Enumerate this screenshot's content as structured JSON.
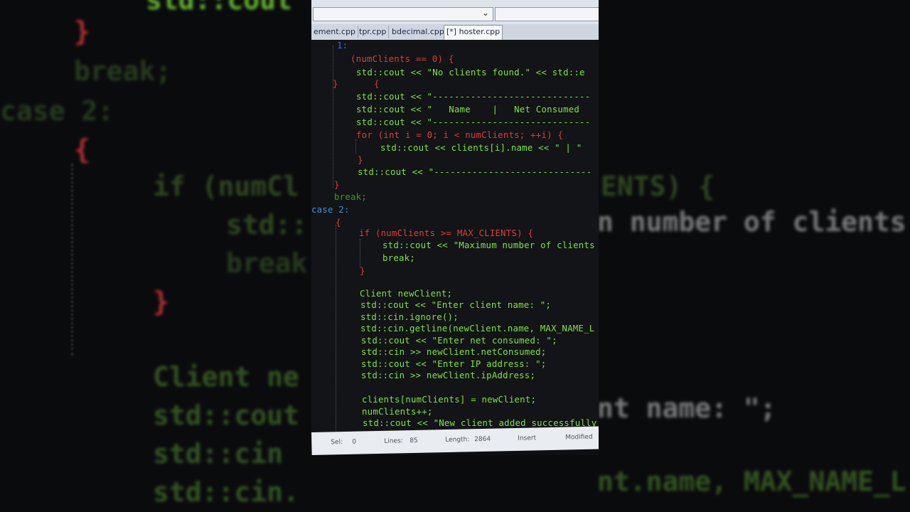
{
  "background": {
    "lines": [
      "std::cout",
      "}",
      "break;",
      "case 2:",
      "{",
      "if (numCl",
      "ENTS) {",
      "std::",
      "n number of clients",
      "break",
      "}",
      "Client ne",
      "std::cout",
      "nt name: \";",
      "std::cin",
      "std::cin.",
      "nt.name, MAX_NAME_L"
    ]
  },
  "tabs": [
    {
      "label": "ement.cpp"
    },
    {
      "label": "tpr.cpp"
    },
    {
      "label": "bdecimal.cpp"
    },
    {
      "label": "[*] hoster.cpp"
    }
  ],
  "code_lines": [
    "1:",
    "(numClients == 0) {",
    "std::cout << \"No clients found.\" << std::e",
    "}",
    "{",
    "std::cout << \"-----------------------------",
    "std::cout << \"   Name    |   Net Consumed",
    "std::cout << \"-----------------------------",
    "for (int i = 0; i < numClients; ++i) {",
    "std::cout << clients[i].name << \" | \"",
    "}",
    "std::cout << \"-----------------------------",
    "}",
    "break;",
    "case 2:",
    "{",
    "if (numClients >= MAX_CLIENTS) {",
    "std::cout << \"Maximum number of clients",
    "break;",
    "}",
    "Client newClient;",
    "std::cout << \"Enter client name: \";",
    "std::cin.ignore();",
    "std::cin.getline(newClient.name, MAX_NAME_L",
    "std::cout << \"Enter net consumed: \";",
    "std::cin >> newClient.netConsumed;",
    "std::cout << \"Enter IP address: \";",
    "std::cin >> newClient.ipAddress;",
    "clients[numClients] = newClient;",
    "numClients++;",
    "std::cout << \"New client added successfully"
  ],
  "status": {
    "sel_label": "Sel:",
    "sel_value": "0",
    "lines_label": "Lines:",
    "lines_value": "85",
    "length_label": "Length:",
    "length_value": "2864",
    "mode": "Insert",
    "state": "Modified"
  },
  "colors": {
    "keyword": "#e23a3a",
    "identifier": "#7ee33a",
    "string": "#e8e8e8",
    "number": "#b53bd8",
    "editor_bg": "#121418"
  }
}
